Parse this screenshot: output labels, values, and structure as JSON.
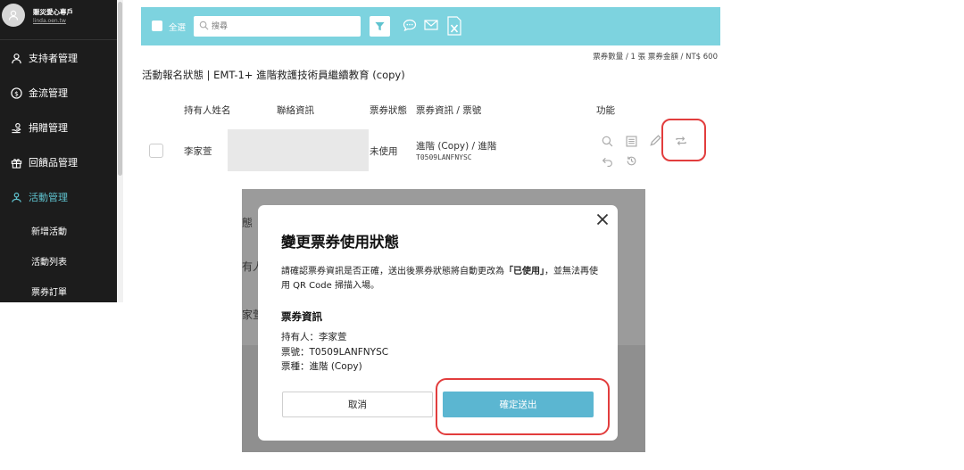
{
  "sidebar": {
    "user_name": "賑災愛心專戶",
    "user_link": "linda.oen.tw",
    "items": [
      {
        "label": "支持者管理",
        "icon": "person-icon"
      },
      {
        "label": "金流管理",
        "icon": "dollar-icon"
      },
      {
        "label": "捐贈管理",
        "icon": "donate-icon"
      },
      {
        "label": "回饋品管理",
        "icon": "gift-icon"
      },
      {
        "label": "活動管理",
        "icon": "event-icon",
        "active": true
      }
    ],
    "subitems": [
      "新增活動",
      "活動列表",
      "票券訂單"
    ],
    "accent_color": "#5fc3cf"
  },
  "toolbar": {
    "select_all_label": "全選",
    "search_placeholder": "搜尋",
    "background_color": "#7dd3df"
  },
  "totals": "票券數量 / 1 張  票券金額 / NT$ 600",
  "page_heading": "活動報名狀態 | EMT-1+ 進階救護技術員繼續教育 (copy)",
  "table": {
    "headers": {
      "holder": "持有人姓名",
      "contact": "聯絡資訊",
      "status": "票券狀態",
      "ticket": "票券資訊 / 票號",
      "actions": "功能"
    },
    "row": {
      "holder": "李家萱",
      "status": "未使用",
      "ticket_type": "進階 (Copy) / 進階",
      "ticket_no": "T0509LANFNYSC"
    }
  },
  "background_ghost": {
    "line1": "態",
    "line2": "有人",
    "line3": "家萱"
  },
  "modal": {
    "title": "變更票券使用狀態",
    "text_before": "請確認票券資訊是否正確，送出後票券狀態將自動更改為",
    "text_bold": "「已使用」",
    "text_after": "，並無法再使用 QR Code 掃描入場。",
    "section_title": "票券資訊",
    "holder_line": "持有人：李家萱",
    "ticket_no_line": "票號：T0509LANFNYSC",
    "ticket_type_line": "票種：進階 (Copy)",
    "cancel_label": "取消",
    "confirm_label": "確定送出",
    "confirm_color": "#5bb6d1",
    "highlight_color": "#e23d3d"
  }
}
